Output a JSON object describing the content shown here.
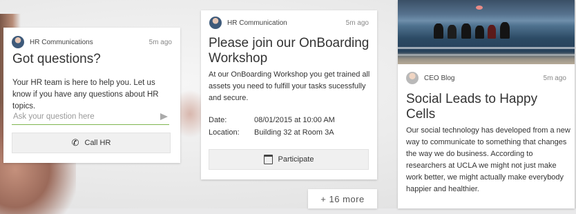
{
  "hr_card": {
    "source": "HR Communications",
    "time": "5m ago",
    "title": "Got questions?",
    "text": "Your HR team is here to help you. Let us know if you have any questions about HR topics.",
    "input_placeholder": "Ask your question here",
    "send_icon": "send-icon",
    "call_label": "Call HR",
    "call_icon": "phone-icon"
  },
  "onboarding_card": {
    "source": "HR Communication",
    "time": "5m ago",
    "title": "Please join our OnBoarding Workshop",
    "text": "At our OnBoarding Workshop you get trained all assets you need to fulfill your tasks sucessfully and secure.",
    "date_label": "Date:",
    "date_value": "08/01/2015 at 10:00 AM",
    "location_label": "Location:",
    "location_value": "Building 32 at Room 3A",
    "participate_label": "Participate",
    "participate_icon": "calendar-icon"
  },
  "more": {
    "label": "+ 16 more"
  },
  "blog_card": {
    "source": "CEO Blog",
    "time": "5m ago",
    "title": "Social Leads to Happy Cells",
    "text": "Our social technology has developed from a new way to communicate to something that changes the way we do business. According to researchers at UCLA we might not just make work better, we might actually make everybody happier and healthier."
  },
  "colors": {
    "input_underline": "#7fb650",
    "button_bg": "#f0f0f0",
    "card_bg": "#ffffff"
  }
}
